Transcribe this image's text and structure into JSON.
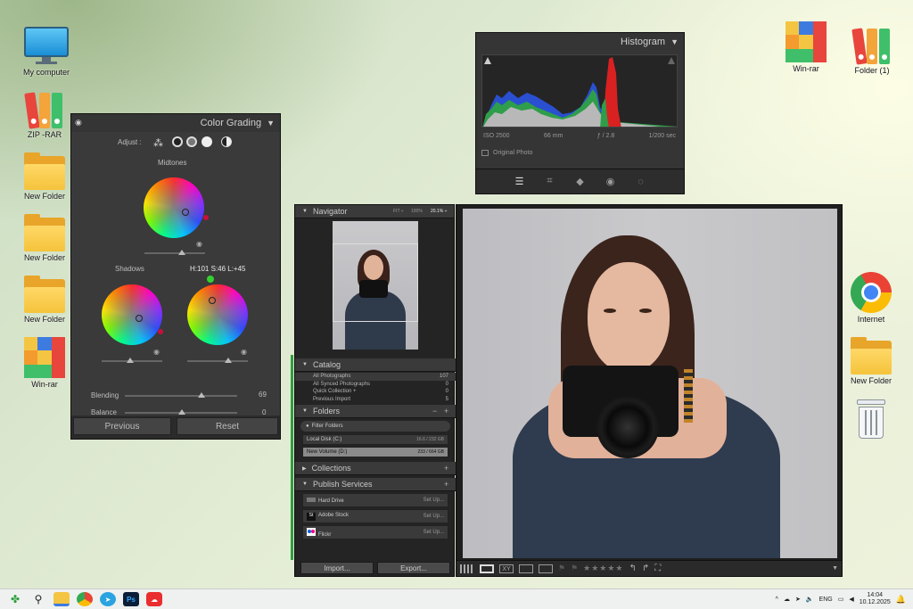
{
  "desktop": {
    "icons_left": [
      {
        "label": "My computer",
        "icon": "monitor-icon"
      },
      {
        "label": "ZIP -RAR",
        "icon": "binders-icon"
      },
      {
        "label": "New Folder",
        "icon": "folder-icon"
      },
      {
        "label": "New Folder",
        "icon": "folder-icon"
      },
      {
        "label": "New Folder",
        "icon": "folder-icon"
      },
      {
        "label": "Win-rar",
        "icon": "winrar-icon"
      }
    ],
    "icons_top_right": [
      {
        "label": "Win-rar",
        "icon": "winrar-icon"
      },
      {
        "label": "Folder (1)",
        "icon": "binders-icon"
      }
    ],
    "icons_right": [
      {
        "label": "Internet",
        "icon": "chrome-icon"
      },
      {
        "label": "New Folder",
        "icon": "folder-icon"
      },
      {
        "label": "",
        "icon": "recycle-bin-icon"
      }
    ]
  },
  "color_grading": {
    "title": "Color Grading",
    "adjust_label": "Adjust :",
    "midtones_label": "Midtones",
    "shadows_label": "Shadows",
    "hsl_readout": "H:101 S:46 L:+45",
    "blending_label": "Blending",
    "blending_value": "69",
    "balance_label": "Balance",
    "balance_value": "0",
    "previous_label": "Previous",
    "reset_label": "Reset"
  },
  "histogram": {
    "title": "Histogram",
    "iso": "ISO 2500",
    "focal": "66 mm",
    "aperture": "ƒ / 2.8",
    "shutter": "1/200 sec",
    "original_photo": "Original Photo"
  },
  "lightroom": {
    "navigator": {
      "title": "Navigator",
      "fit": "FIT ÷",
      "zoom100": "100%",
      "zoom_sel": "20.1% ÷"
    },
    "catalog": {
      "title": "Catalog",
      "items": [
        {
          "label": "All Photographs",
          "count": "107"
        },
        {
          "label": "All Synced Photographs",
          "count": "0"
        },
        {
          "label": "Quick Collection +",
          "count": "0"
        },
        {
          "label": "Previous Import",
          "count": "5"
        }
      ]
    },
    "folders": {
      "title": "Folders",
      "filter": "Filter Folders",
      "volumes": [
        {
          "label": "Local Disk (C:)",
          "size": "16.6 / 232 GB"
        },
        {
          "label": "New Volume (D:)",
          "size": "233 / 664 GB"
        }
      ]
    },
    "collections_title": "Collections",
    "publish": {
      "title": "Publish Services",
      "items": [
        {
          "label": "Hard Drive",
          "action": "Set Up..."
        },
        {
          "label": "Adobe Stock",
          "action": "Set Up..."
        },
        {
          "label": "Flickr",
          "action": "Set Up..."
        }
      ]
    },
    "import_label": "Import...",
    "export_label": "Export...",
    "rating": "★★★★★"
  },
  "taskbar": {
    "lang": "ENG",
    "time": "14:04",
    "date": "10.12.2025"
  },
  "colors": {
    "accent_green": "#34d12f",
    "accent_red": "#d61a3c",
    "lr_bg": "#242424"
  }
}
